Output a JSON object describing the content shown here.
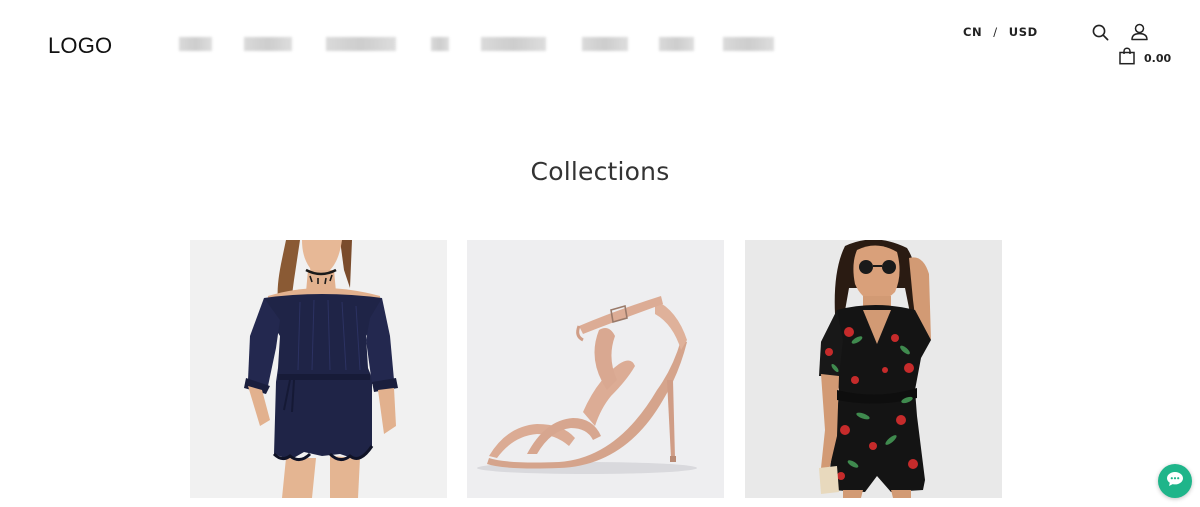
{
  "header": {
    "logo_text": "LOGO",
    "nav_items": [
      "",
      "",
      "",
      "",
      "",
      "",
      "",
      ""
    ],
    "nav_note": "menu labels are blurred/obscured in the screenshot",
    "locale": {
      "language": "CN",
      "separator": "/",
      "currency": "USD"
    },
    "cart_total": "0.00",
    "icons": [
      "search-icon",
      "account-icon",
      "shopping-bag-icon"
    ]
  },
  "main": {
    "title": "Collections",
    "collections": [
      {
        "image_subject": "navy off-shoulder romper"
      },
      {
        "image_subject": "nude strappy high-heel sandal"
      },
      {
        "image_subject": "black floral print romper"
      }
    ]
  },
  "widgets": {
    "chat_icon": "chat-bubble-icon",
    "chat_color": "#1fb58a"
  }
}
